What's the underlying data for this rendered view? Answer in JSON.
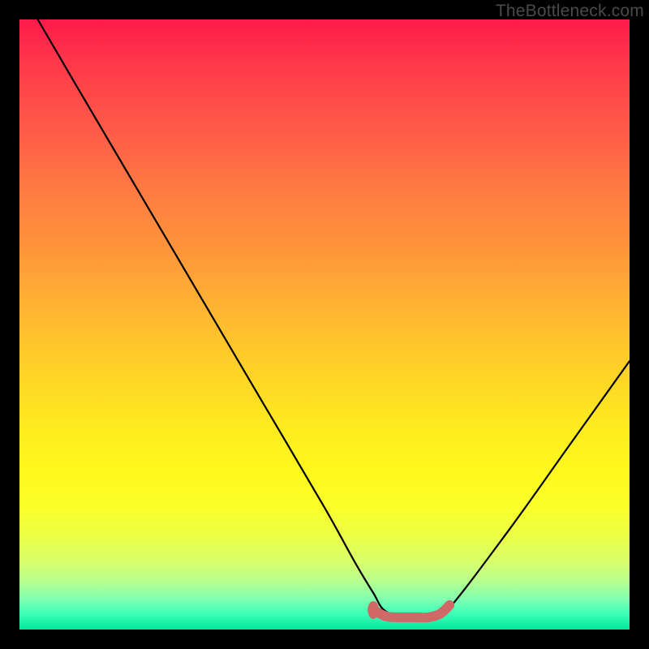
{
  "watermark": "TheBottleneck.com",
  "chart_data": {
    "type": "line",
    "title": "",
    "xlabel": "",
    "ylabel": "",
    "xlim": [
      0,
      100
    ],
    "ylim": [
      0,
      100
    ],
    "background_gradient": {
      "top": "#ff1a4b",
      "middle": "#ffe91f",
      "bottom": "#00e79a"
    },
    "series": [
      {
        "name": "bottleneck-curve",
        "color": "#000000",
        "x": [
          3,
          10,
          20,
          30,
          40,
          50,
          55,
          58,
          60,
          64,
          67,
          70,
          80,
          90,
          100
        ],
        "y": [
          100,
          88,
          71,
          54,
          37,
          20,
          11,
          6,
          3,
          2,
          2,
          3,
          16,
          30,
          44
        ]
      },
      {
        "name": "highlight-segment",
        "color": "#d56a6a",
        "x": [
          58,
          60,
          62,
          65,
          67,
          69,
          70.5
        ],
        "y": [
          3.2,
          2.2,
          2.0,
          2.0,
          2.0,
          2.6,
          4.0
        ]
      }
    ],
    "highlight_marker": {
      "x": 58,
      "y": 3.2
    }
  }
}
